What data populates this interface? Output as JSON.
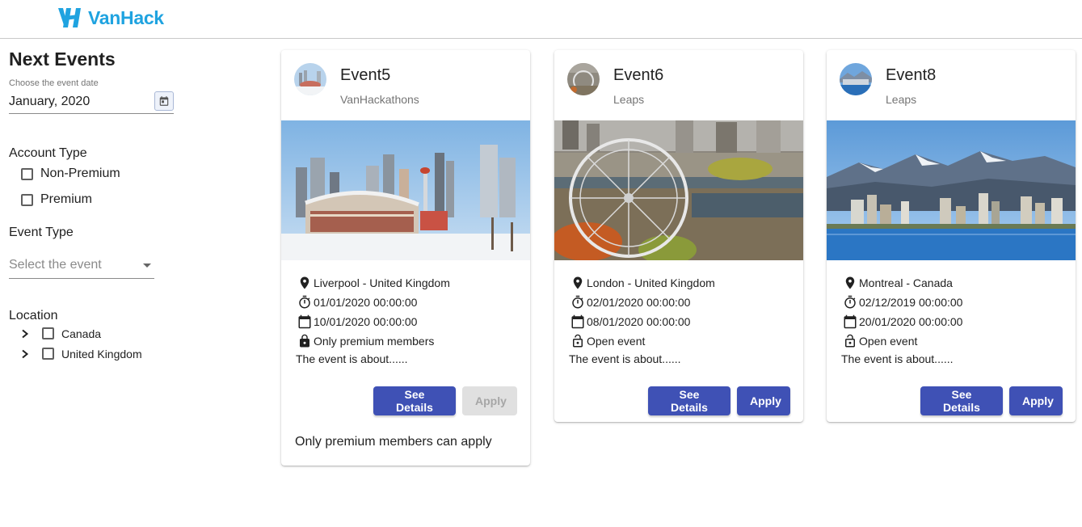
{
  "brand": {
    "name": "VanHack",
    "color": "#1fa3e0"
  },
  "sidebar": {
    "title": "Next Events",
    "date_caption": "Choose the event date",
    "date_value": "January, 2020",
    "account_type_label": "Account Type",
    "account_types": [
      {
        "label": "Non-Premium",
        "checked": false
      },
      {
        "label": "Premium",
        "checked": false
      }
    ],
    "event_type_label": "Event Type",
    "event_type_placeholder": "Select the event",
    "location_label": "Location",
    "locations": [
      {
        "label": "Canada",
        "checked": false,
        "expanded": false
      },
      {
        "label": "United Kingdom",
        "checked": false,
        "expanded": false
      }
    ]
  },
  "cards": [
    {
      "title": "Event5",
      "subtitle": "VanHackathons",
      "location": "Liverpool - United Kingdom",
      "start": "01/01/2020 00:00:00",
      "end": "10/01/2020 00:00:00",
      "access": "Only premium members",
      "access_icon": "lock-icon",
      "about": "The event is about......",
      "details_label": "See Details",
      "apply_label": "Apply",
      "apply_enabled": false,
      "note": "Only premium members can apply",
      "image": "calgary-saddledome-skyline"
    },
    {
      "title": "Event6",
      "subtitle": "Leaps",
      "location": "London - United Kingdom",
      "start": "02/01/2020 00:00:00",
      "end": "08/01/2020 00:00:00",
      "access": "Open event",
      "access_icon": "lock-open-icon",
      "about": "The event is about......",
      "details_label": "See Details",
      "apply_label": "Apply",
      "apply_enabled": true,
      "image": "ferris-wheel-city"
    },
    {
      "title": "Event8",
      "subtitle": "Leaps",
      "location": "Montreal - Canada",
      "start": "02/12/2019 00:00:00",
      "end": "20/01/2020 00:00:00",
      "access": "Open event",
      "access_icon": "lock-open-icon",
      "about": "The event is about......",
      "details_label": "See Details",
      "apply_label": "Apply",
      "apply_enabled": true,
      "image": "mountains-waterfront-skyline"
    }
  ],
  "colors": {
    "primary": "#3f51b5",
    "disabled": "#e0e0e0"
  }
}
